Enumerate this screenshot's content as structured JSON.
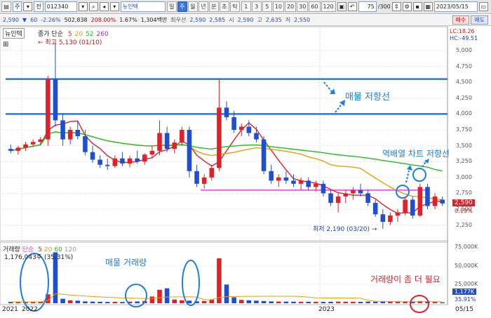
{
  "toolbar": {
    "menu_btn": "▤",
    "type_select": "주",
    "market_select": "전",
    "code_input": "012340",
    "stock_name": "뉴인텍",
    "periods": [
      "일",
      "주",
      "월",
      "년",
      "분",
      "초",
      "틱"
    ],
    "active_period": "주",
    "intervals": [
      "1",
      "3",
      "5",
      "10",
      "20",
      "30",
      "60",
      "120"
    ],
    "count_input": "75",
    "count_total": "/300",
    "date_input": "2023/05/15"
  },
  "quote": {
    "price": "2,590",
    "change": "60",
    "change_rate": "-2.26%",
    "volume": "502,838",
    "volume_ratio": "208.00%",
    "turnover_ratio": "1.67%",
    "amount": "1,304백만",
    "best_ask_label": "최우선",
    "best_ask": "2,590",
    "best_bid": "2,585",
    "open_label": "시",
    "open": "2,590",
    "high_label": "고",
    "high": "2,635",
    "low_label": "저",
    "low": "2,550",
    "buy_label": "매수",
    "sell_label": "매도"
  },
  "price_pane": {
    "name": "뉴인텍",
    "ma_legend_label": "종가 단순",
    "ma_periods": [
      "5",
      "20",
      "52",
      "260"
    ],
    "ma_colors": [
      "#e0202a",
      "#e8a000",
      "#1fbf1f",
      "#a02fa0"
    ],
    "max_label": "최고 5,130 (01/10)",
    "min_label": "최저 2,190 (03/20)",
    "lc": "LC:18.26",
    "hc": "HC:-49.51",
    "axis_ticks": [
      "5,000",
      "4,750",
      "4,500",
      "4,250",
      "4,000",
      "3,750",
      "3,500",
      "3,250",
      "3,000",
      "2,750",
      "2,500",
      "2,250"
    ],
    "current_price": "2,590",
    "current_pct": "0.19%"
  },
  "volume_pane": {
    "label": "거래량",
    "ma_legend_label": "단순",
    "ma_periods": [
      "5",
      "20",
      "60",
      "120"
    ],
    "value_label": "1,176,043주 (35.31%)",
    "axis_ticks": [
      "75,000K",
      "50,000K",
      "25,000K"
    ],
    "current_vol": "1,177K",
    "current_pct": "35.91%"
  },
  "x_axis": {
    "labels": [
      "2021",
      "2022",
      "2023"
    ],
    "right_date": "05/15"
  },
  "annotations": {
    "resistance": "매물 저항선",
    "reverse": "역배열 차트 저항선",
    "supply_volume": "매물 거래량",
    "need_volume": "거래량이 좀 더 필요"
  },
  "colors": {
    "up": "#e0202a",
    "down": "#1f4fd1",
    "annot": "#1a7ee6",
    "need": "#e0202a"
  },
  "chart_data": {
    "type": "candlestick",
    "ylim": [
      2100,
      5200
    ],
    "resistance_levels": [
      4550,
      4000
    ],
    "reverse_line_level": 2800,
    "ohlc": [
      [
        3450,
        3520,
        3380,
        3420
      ],
      [
        3420,
        3500,
        3360,
        3470
      ],
      [
        3470,
        3560,
        3420,
        3520
      ],
      [
        3520,
        3600,
        3480,
        3560
      ],
      [
        3560,
        3640,
        3510,
        3600
      ],
      [
        3600,
        4600,
        3500,
        4550
      ],
      [
        4550,
        5130,
        3800,
        3900
      ],
      [
        3900,
        4000,
        3500,
        3600
      ],
      [
        3600,
        3800,
        3520,
        3750
      ],
      [
        3750,
        3900,
        3600,
        3650
      ],
      [
        3650,
        3750,
        3350,
        3400
      ],
      [
        3400,
        3500,
        3230,
        3280
      ],
      [
        3280,
        3350,
        3150,
        3200
      ],
      [
        3200,
        3300,
        3120,
        3180
      ],
      [
        3180,
        3350,
        3150,
        3300
      ],
      [
        3300,
        3400,
        3180,
        3220
      ],
      [
        3220,
        3340,
        3160,
        3300
      ],
      [
        3300,
        3420,
        3220,
        3250
      ],
      [
        3250,
        3380,
        3200,
        3360
      ],
      [
        3360,
        3500,
        3300,
        3420
      ],
      [
        3420,
        3900,
        3350,
        3700
      ],
      [
        3700,
        3800,
        3400,
        3450
      ],
      [
        3450,
        3600,
        3380,
        3550
      ],
      [
        3550,
        3800,
        3500,
        3750
      ],
      [
        3750,
        3800,
        3000,
        3100
      ],
      [
        3100,
        3200,
        2850,
        2900
      ],
      [
        2900,
        3050,
        2820,
        3000
      ],
      [
        3000,
        3200,
        2950,
        3150
      ],
      [
        3150,
        4550,
        3100,
        4100
      ],
      [
        4100,
        4200,
        3900,
        3950
      ],
      [
        3950,
        4050,
        3700,
        3750
      ],
      [
        3750,
        3850,
        3650,
        3800
      ],
      [
        3800,
        3900,
        3650,
        3700
      ],
      [
        3700,
        3800,
        3550,
        3600
      ],
      [
        3600,
        3650,
        3050,
        3100
      ],
      [
        3100,
        3200,
        2900,
        2950
      ],
      [
        2950,
        3050,
        2850,
        3000
      ],
      [
        3000,
        3100,
        2900,
        2950
      ],
      [
        2950,
        3050,
        2850,
        2900
      ],
      [
        2900,
        3000,
        2800,
        2950
      ],
      [
        2950,
        3000,
        2800,
        2850
      ],
      [
        2850,
        2950,
        2780,
        2900
      ],
      [
        2900,
        2950,
        2700,
        2750
      ],
      [
        2750,
        2800,
        2550,
        2600
      ],
      [
        2600,
        2750,
        2450,
        2700
      ],
      [
        2700,
        2800,
        2600,
        2750
      ],
      [
        2750,
        2850,
        2650,
        2800
      ],
      [
        2800,
        2900,
        2700,
        2750
      ],
      [
        2750,
        2800,
        2550,
        2600
      ],
      [
        2600,
        2650,
        2380,
        2420
      ],
      [
        2420,
        2500,
        2190,
        2300
      ],
      [
        2300,
        2450,
        2250,
        2400
      ],
      [
        2400,
        2500,
        2300,
        2450
      ],
      [
        2450,
        2700,
        2400,
        2650
      ],
      [
        2650,
        2700,
        2350,
        2400
      ],
      [
        2400,
        2900,
        2380,
        2850
      ],
      [
        2850,
        2900,
        2500,
        2550
      ],
      [
        2550,
        2750,
        2500,
        2700
      ],
      [
        2650,
        2700,
        2550,
        2590
      ]
    ],
    "volume_k": [
      1800,
      1900,
      1700,
      2200,
      2000,
      12000,
      68000,
      6000,
      4000,
      3500,
      2500,
      2200,
      2000,
      1800,
      1900,
      1700,
      2200,
      2400,
      3000,
      9000,
      18000,
      20000,
      5000,
      4000,
      3500,
      2500,
      3000,
      5000,
      60000,
      25000,
      8000,
      4500,
      4000,
      3500,
      3000,
      2500,
      2300,
      2200,
      2100,
      2000,
      2000,
      1900,
      1800,
      2000,
      2200,
      2100,
      2000,
      1900,
      2200,
      2000,
      2400,
      2100,
      2000,
      2500,
      2200,
      3000,
      2600,
      2300,
      1177
    ]
  }
}
